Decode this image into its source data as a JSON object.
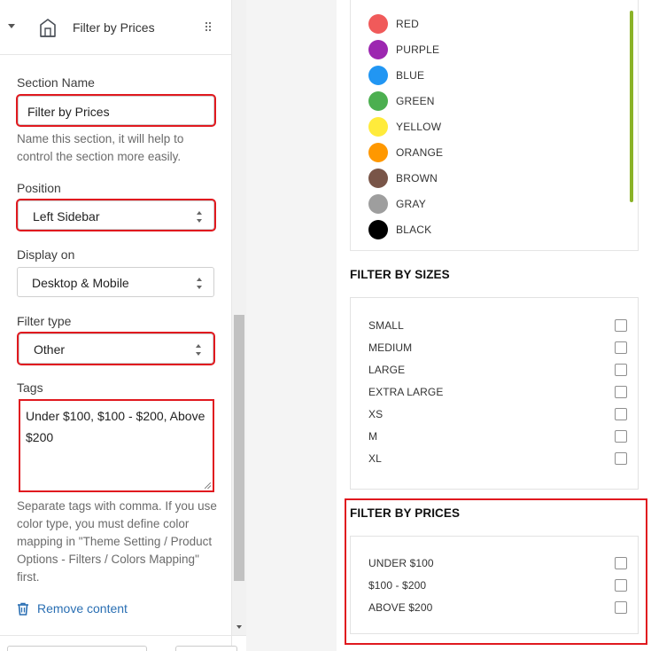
{
  "panel": {
    "title": "Filter by Prices",
    "section_name": {
      "label": "Section Name",
      "value": "Filter by Prices",
      "help": "Name this section, it will help to control the section more easily."
    },
    "position": {
      "label": "Position",
      "value": "Left Sidebar"
    },
    "display_on": {
      "label": "Display on",
      "value": "Desktop & Mobile"
    },
    "filter_type": {
      "label": "Filter type",
      "value": "Other"
    },
    "tags": {
      "label": "Tags",
      "value": "Under $100, $100 - $200, Above $200",
      "help": "Separate tags with comma. If you use color type, you must define color mapping in \"Theme Setting / Product Options - Filters / Colors Mapping\" first."
    },
    "remove_label": "Remove content"
  },
  "preview": {
    "colors": [
      {
        "name": "RED",
        "color": "#f05a5a"
      },
      {
        "name": "PURPLE",
        "color": "#9c27b0"
      },
      {
        "name": "BLUE",
        "color": "#2196f3"
      },
      {
        "name": "GREEN",
        "color": "#4caf50"
      },
      {
        "name": "YELLOW",
        "color": "#ffeb3b"
      },
      {
        "name": "ORANGE",
        "color": "#ff9800"
      },
      {
        "name": "BROWN",
        "color": "#795548"
      },
      {
        "name": "GRAY",
        "color": "#9e9e9e"
      },
      {
        "name": "BLACK",
        "color": "#000000"
      }
    ],
    "sizes": {
      "title": "FILTER BY SIZES",
      "items": [
        "SMALL",
        "MEDIUM",
        "LARGE",
        "EXTRA LARGE",
        "XS",
        "M",
        "XL"
      ]
    },
    "prices": {
      "title": "FILTER BY PRICES",
      "items": [
        "UNDER $100",
        "$100 - $200",
        "ABOVE $200"
      ]
    }
  },
  "colors": {
    "highlight": "#e0191f",
    "link": "#2a6fb3",
    "scroll_accent": "#8bb328"
  }
}
